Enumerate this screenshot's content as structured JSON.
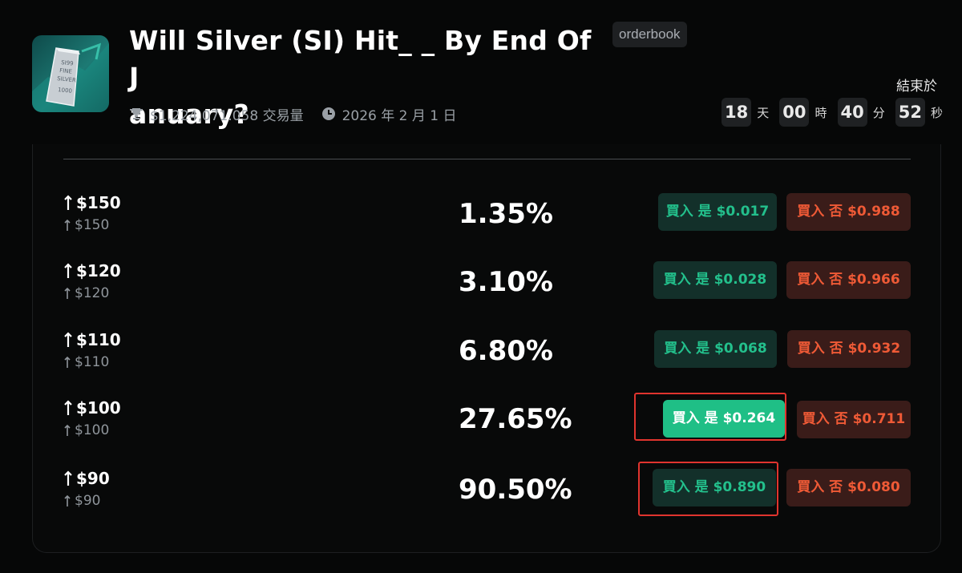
{
  "market": {
    "title": "Will Silver (SI) Hit_ _ By End Of J\nanuary?",
    "badge": "orderbook",
    "volume": "$1,224,071.058 交易量",
    "end_date": "2026 年 2 月 1 日",
    "thumbnail_icon": "silver-bar-image",
    "thumbnail_text": [
      "SI99",
      "FINE",
      "SILVER",
      "1000"
    ]
  },
  "countdown": {
    "label": "結束於",
    "days": "18",
    "days_unit": "天",
    "hours": "00",
    "hours_unit": "時",
    "minutes": "40",
    "minutes_unit": "分",
    "seconds": "52",
    "seconds_unit": "秒"
  },
  "outcomes": [
    {
      "name": "$150",
      "sub": "$150",
      "probability": "1.35%",
      "yes": "買入 是 $0.017",
      "no": "買入 否 $0.988"
    },
    {
      "name": "$120",
      "sub": "$120",
      "probability": "3.10%",
      "yes": "買入 是 $0.028",
      "no": "買入 否 $0.966"
    },
    {
      "name": "$110",
      "sub": "$110",
      "probability": "6.80%",
      "yes": "買入 是 $0.068",
      "no": "買入 否 $0.932"
    },
    {
      "name": "$100",
      "sub": "$100",
      "probability": "27.65%",
      "yes": "買入 是 $0.264",
      "no": "買入 否 $0.711"
    },
    {
      "name": "$90",
      "sub": "$90",
      "probability": "90.50%",
      "yes": "買入 是 $0.890",
      "no": "買入 否 $0.080"
    }
  ],
  "colors": {
    "yes_text": "#23c08c",
    "yes_bg": "#13302a",
    "yes_active_bg": "#1fbf86",
    "no_text": "#ef5a36",
    "no_bg": "#3a1c19",
    "highlight_box": "#e0342e"
  }
}
